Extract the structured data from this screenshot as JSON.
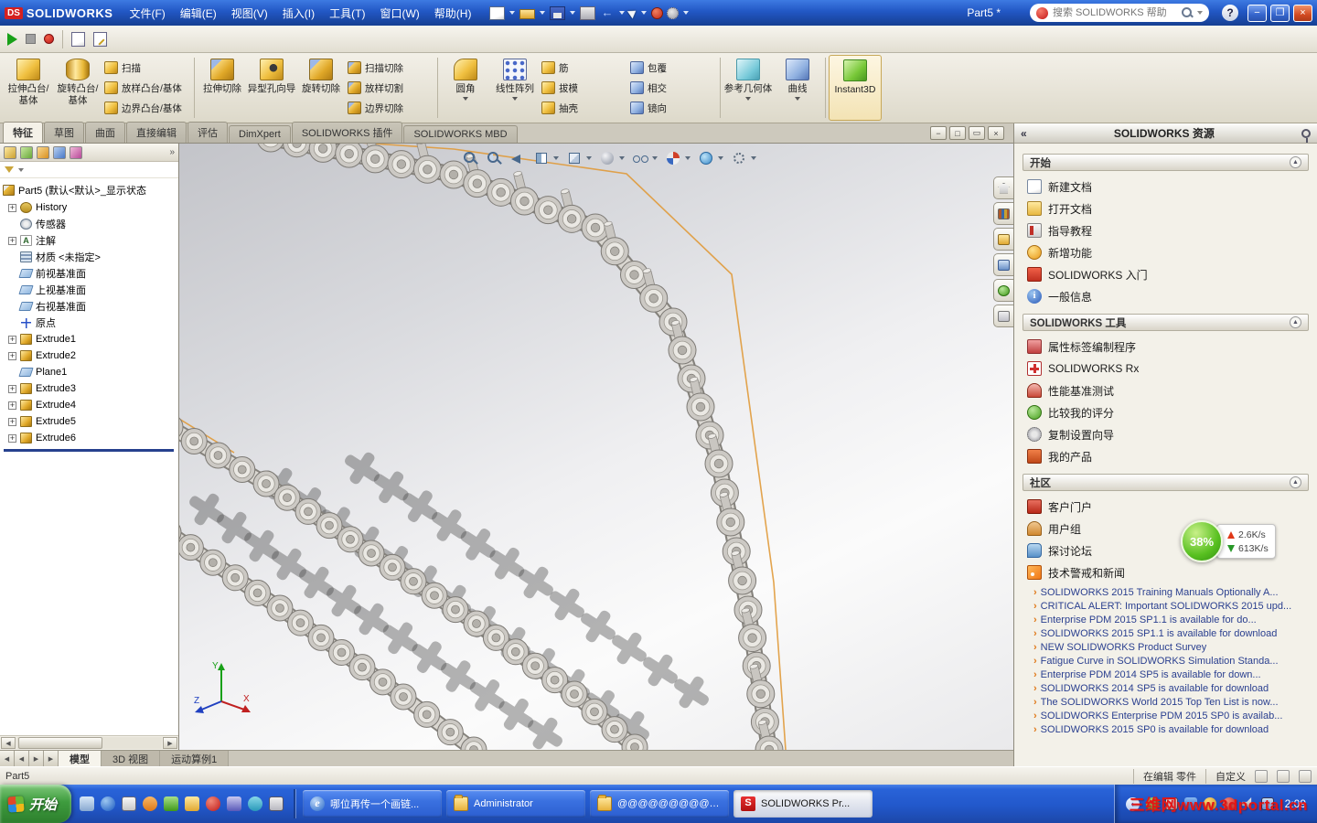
{
  "titlebar": {
    "logo_mark": "DS",
    "logo_text": "SOLIDWORKS",
    "menus": [
      "文件(F)",
      "编辑(E)",
      "视图(V)",
      "插入(I)",
      "工具(T)",
      "窗口(W)",
      "帮助(H)"
    ],
    "doc_title": "Part5 *",
    "search_placeholder": "搜索 SOLIDWORKS 帮助",
    "help_label": "?",
    "minimize_glyph": "−",
    "restore_glyph": "❐",
    "close_glyph": "×"
  },
  "ribbon": {
    "extrude_boss": "拉伸凸台/基体",
    "revolve_boss": "旋转凸台/基体",
    "sweep": "扫描",
    "loft": "放样凸台/基体",
    "boundary": "边界凸台/基体",
    "extrude_cut": "拉伸切除",
    "hole_wizard": "异型孔向导",
    "revolve_cut": "旋转切除",
    "sweep_cut": "扫描切除",
    "loft_cut": "放样切割",
    "boundary_cut": "边界切除",
    "fillet": "圆角",
    "linear_pattern": "线性阵列",
    "rib": "筋",
    "draft": "拔模",
    "shell": "抽壳",
    "wrap": "包覆",
    "intersect": "相交",
    "mirror": "镜向",
    "ref_geometry": "参考几何体",
    "curves": "曲线",
    "instant3d": "Instant3D"
  },
  "command_tabs": [
    {
      "label": "特征",
      "state": "active"
    },
    {
      "label": "草图",
      "state": "normal"
    },
    {
      "label": "曲面",
      "state": "normal"
    },
    {
      "label": "直接编辑",
      "state": "normal"
    },
    {
      "label": "评估",
      "state": "normal"
    },
    {
      "label": "DimXpert",
      "state": "normal"
    },
    {
      "label": "SOLIDWORKS 插件",
      "state": "normal"
    },
    {
      "label": "SOLIDWORKS MBD",
      "state": "normal"
    }
  ],
  "feature_tree": {
    "root": "Part5 (默认<默认>_显示状态",
    "items": [
      {
        "exp": "exp",
        "icon": "ic-history",
        "label": "History"
      },
      {
        "exp": "noexp",
        "icon": "ic-sensor",
        "label": "传感器"
      },
      {
        "exp": "exp",
        "icon": "ic-ann",
        "label": "注解"
      },
      {
        "exp": "noexp",
        "icon": "ic-mat",
        "label": "材质 <未指定>"
      },
      {
        "exp": "noexp",
        "icon": "ic-plane",
        "label": "前视基准面"
      },
      {
        "exp": "noexp",
        "icon": "ic-plane",
        "label": "上视基准面"
      },
      {
        "exp": "noexp",
        "icon": "ic-plane",
        "label": "右视基准面"
      },
      {
        "exp": "noexp",
        "icon": "ic-origin",
        "label": "原点"
      },
      {
        "exp": "exp",
        "icon": "ic-extrude",
        "label": "Extrude1"
      },
      {
        "exp": "exp",
        "icon": "ic-extrude",
        "label": "Extrude2"
      },
      {
        "exp": "noexp",
        "icon": "ic-plane",
        "label": "Plane1"
      },
      {
        "exp": "exp",
        "icon": "ic-extrude",
        "label": "Extrude3"
      },
      {
        "exp": "exp",
        "icon": "ic-extrude",
        "label": "Extrude4"
      },
      {
        "exp": "exp",
        "icon": "ic-extrude",
        "label": "Extrude5"
      },
      {
        "exp": "exp",
        "icon": "ic-extrude",
        "label": "Extrude6"
      }
    ]
  },
  "triad": {
    "x": "X",
    "y": "Y",
    "z": "Z"
  },
  "taskpane": {
    "title": "SOLIDWORKS 资源",
    "sections": [
      {
        "title": "开始",
        "items": [
          {
            "icon": "tp-new",
            "label": "新建文档"
          },
          {
            "icon": "tp-open",
            "label": "打开文档"
          },
          {
            "icon": "tp-tutorial",
            "label": "指导教程"
          },
          {
            "icon": "tp-newfeat",
            "label": "新增功能"
          },
          {
            "icon": "tp-start",
            "label": "SOLIDWORKS 入门"
          },
          {
            "icon": "tp-info",
            "label": "一般信息"
          }
        ]
      },
      {
        "title": "SOLIDWORKS 工具",
        "items": [
          {
            "icon": "tp-prop",
            "label": "属性标签编制程序"
          },
          {
            "icon": "tp-rx",
            "label": "SOLIDWORKS Rx"
          },
          {
            "icon": "tp-bench",
            "label": "性能基准测试"
          },
          {
            "icon": "tp-compare",
            "label": "比较我的评分"
          },
          {
            "icon": "tp-copy",
            "label": "复制设置向导"
          },
          {
            "icon": "tp-products",
            "label": "我的产品"
          }
        ]
      },
      {
        "title": "社区",
        "items": [
          {
            "icon": "tp-portal",
            "label": "客户门户"
          },
          {
            "icon": "tp-group",
            "label": "用户组"
          },
          {
            "icon": "tp-forum",
            "label": "探讨论坛"
          },
          {
            "icon": "tp-news",
            "label": "技术警戒和新闻"
          }
        ]
      }
    ],
    "news": [
      "SOLIDWORKS 2015 Training Manuals Optionally A...",
      "CRITICAL ALERT: Important SOLIDWORKS 2015 upd...",
      "Enterprise PDM 2015 SP1.1 is available for do...",
      "SOLIDWORKS 2015 SP1.1 is available for download",
      "NEW SOLIDWORKS Product Survey",
      "Fatigue Curve in SOLIDWORKS Simulation Standa...",
      "Enterprise PDM 2014 SP5 is available for down...",
      "SOLIDWORKS 2014 SP5 is available for download",
      "The SOLIDWORKS World 2015 Top Ten List is now...",
      "SOLIDWORKS Enterprise PDM 2015 SP0 is availab...",
      "SOLIDWORKS 2015 SP0 is available for download"
    ]
  },
  "netmon": {
    "percent": "38%",
    "up": "2.6K/s",
    "down": "613K/s"
  },
  "view_tabs": [
    {
      "label": "模型",
      "state": "active"
    },
    {
      "label": "3D 视图",
      "state": "normal"
    },
    {
      "label": "运动算例1",
      "state": "normal"
    }
  ],
  "statusbar": {
    "left": "Part5",
    "mode": "在编辑 零件",
    "custom": "自定义"
  },
  "taskbar": {
    "start_label": "开始",
    "tasks": [
      {
        "icon": "ti-ie",
        "label": "哪位再传一个画链...",
        "state": "normal"
      },
      {
        "icon": "ti-folder",
        "label": "Administrator",
        "state": "normal"
      },
      {
        "icon": "ti-folder",
        "label": "@@@@@@@@@@@@@@@@...",
        "state": "normal"
      },
      {
        "icon": "ti-sw",
        "label": "SOLIDWORKS Pr...",
        "state": "active"
      }
    ],
    "clock": "2:09"
  },
  "watermark": "三维网www.3dportal.cn",
  "colors": {
    "taskbar_blue": "#2258cb",
    "start_green": "#3e9c3e",
    "watermark_red": "#e41515",
    "accent_orange": "#e09a3a"
  }
}
